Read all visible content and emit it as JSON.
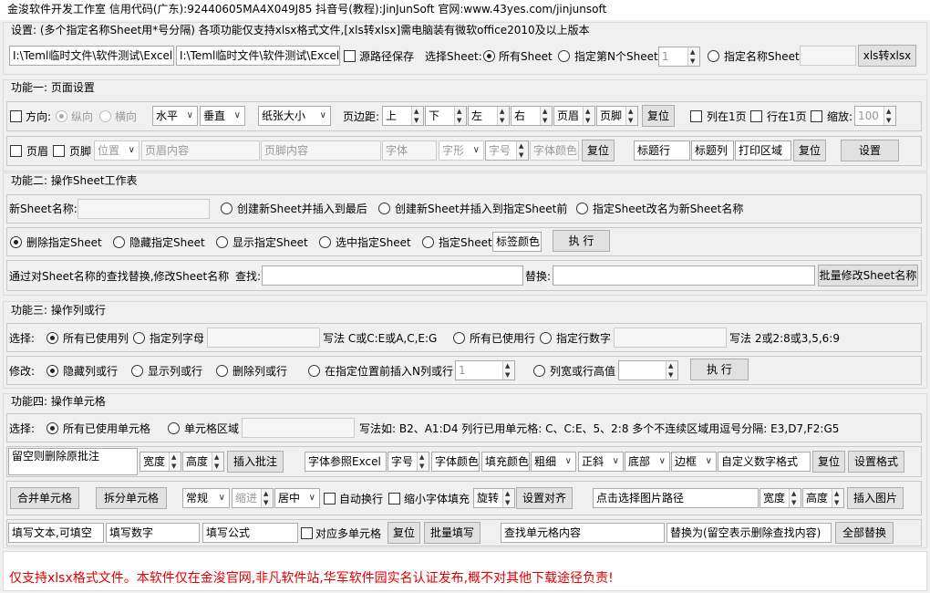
{
  "title": "金浚软件开发工作室   信用代码(广东):92440605MA4X049J85   抖音号(教程):JinJunSoft   官网:www.43yes.com/jinjunsoft",
  "settings": {
    "label": "设置: (多个指定名称Sheet用*号分隔)  各项功能仅支持xlsx格式文件,[xls转xlsx]需电脑装有微软office2010及以上版本",
    "path1": "I:\\Teml临时文件\\软件测试\\ExcelS",
    "path2": "I:\\Teml临时文件\\软件测试\\ExcelS",
    "keep_path": "源路径保存",
    "select_sheet": "选择Sheet:",
    "all_sheet": "所有Sheet",
    "nth_sheet": "指定第N个Sheet",
    "nth_value": "1",
    "named_sheet": "指定名称Sheet",
    "convert_button": "xls转xlsx"
  },
  "f1": {
    "title": "功能一: 页面设置",
    "orientation": "方向:",
    "portrait": "纵向",
    "landscape": "横向",
    "halign": "水平",
    "valign": "垂直",
    "paper": "纸张大小",
    "margin": "页边距:",
    "m_top": "上",
    "m_bottom": "下",
    "m_left": "左",
    "m_right": "右",
    "m_header": "页眉",
    "m_footer": "页脚",
    "reset1": "复位",
    "fit_cols": "列在1页",
    "fit_rows": "行在1页",
    "zoom": "缩放:",
    "zoom_value": "100",
    "hdr": "页眉",
    "ftr": "页脚",
    "position": "位置",
    "hdr_content": "页眉内容",
    "ftr_content": "页脚内容",
    "font": "字体",
    "style": "字形",
    "size": "字号",
    "font_color": "字体颜色",
    "reset2": "复位",
    "title_row": "标题行",
    "title_col": "标题列",
    "print_area": "打印区域",
    "reset3": "复位",
    "apply": "设置"
  },
  "f2": {
    "title": "功能二: 操作Sheet工作表",
    "new_name": "新Sheet名称:",
    "opt_end": "创建新Sheet并插入到最后",
    "opt_before": "创建新Sheet并插入到指定Sheet前",
    "opt_rename": "指定Sheet改名为新Sheet名称",
    "delete": "删除指定Sheet",
    "hide": "隐藏指定Sheet",
    "show": "显示指定Sheet",
    "select": "选中指定Sheet",
    "tab_color_opt": "指定Sheet",
    "tab_color": "标签颜色",
    "run": "执 行",
    "replace_desc": "通过对Sheet名称的查找替换,修改Sheet名称",
    "find": "查找:",
    "replace": "替换:",
    "batch": "批量修改Sheet名称"
  },
  "f3": {
    "title": "功能三: 操作列或行",
    "choose": "选择:",
    "all_cols": "所有已使用列",
    "spec_cols": "指定列字母",
    "col_hint": "写法 C或C:E或A,C,E:G",
    "all_rows": "所有已使用行",
    "spec_rows": "指定行数字",
    "row_hint": "写法 2或2:8或3,5,6:9",
    "modify": "修改:",
    "hide": "隐藏列或行",
    "show": "显示列或行",
    "delete": "删除列或行",
    "insert": "在指定位置前插入N列或行",
    "insert_n": "1",
    "width": "列宽或行高值",
    "run": "执 行"
  },
  "f4": {
    "title": "功能四: 操作单元格",
    "choose": "选择:",
    "all_cells": "所有已使用单元格",
    "range": "单元格区域",
    "hint": "写法如: B2、A1:D4  列行已用单元格: C、C:E、5、2:8  多个不连续区域用逗号分隔: E3,D7,F2:G5",
    "comment": "留空则删除原批注",
    "c_width": "宽度",
    "c_height": "高度",
    "insert_comment": "插入批注",
    "font_ref": "字体参照Excel",
    "font_size": "字号",
    "font_color": "字体颜色",
    "fill_color": "填充颜色",
    "bold": "粗细",
    "italic": "正斜",
    "underline": "底部",
    "border": "边框",
    "num_format": "自定义数字格式",
    "reset": "复位",
    "set_format": "设置格式",
    "merge": "合并单元格",
    "unmerge": "拆分单元格",
    "h_align": "常规",
    "indent": "缩进",
    "v_align": "居中",
    "wrap": "自动换行",
    "shrink": "缩小字体填充",
    "rotate": "旋转",
    "set_align": "设置对齐",
    "img_path": "点击选择图片路径",
    "img_w": "宽度",
    "img_h": "高度",
    "insert_img": "插入图片",
    "text": "填写文本,可填空",
    "number": "填写数字",
    "formula": "填写公式",
    "multi": "对应多单元格",
    "reset2": "复位",
    "batch_fill": "批量填写",
    "find": "查找单元格内容",
    "replace_with": "替换为(留空表示删除查找内容)",
    "replace_all": "全部替换"
  },
  "footer": "仅支持xlsx格式文件。本软件仅在金浚官网,非凡软件站,华军软件园实名认证发布,概不对其他下载途径负责!"
}
